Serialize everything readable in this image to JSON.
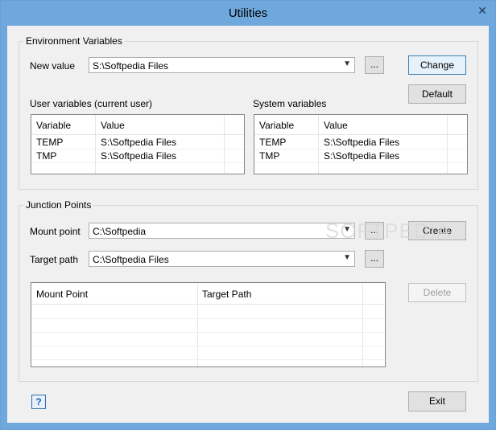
{
  "window": {
    "title": "Utilities"
  },
  "env": {
    "group_label": "Environment Variables",
    "new_value_label": "New value",
    "new_value": "S:\\Softpedia Files",
    "browse_label": "...",
    "change_label": "Change",
    "default_label": "Default",
    "user_vars_label": "User variables (current user)",
    "system_vars_label": "System variables",
    "columns": [
      "Variable",
      "Value"
    ],
    "user_rows": [
      {
        "variable": "TEMP",
        "value": "S:\\Softpedia Files"
      },
      {
        "variable": "TMP",
        "value": "S:\\Softpedia Files"
      }
    ],
    "system_rows": [
      {
        "variable": "TEMP",
        "value": "S:\\Softpedia Files"
      },
      {
        "variable": "TMP",
        "value": "S:\\Softpedia Files"
      }
    ]
  },
  "junction": {
    "group_label": "Junction Points",
    "mount_point_label": "Mount point",
    "mount_point_value": "C:\\Softpedia",
    "target_path_label": "Target path",
    "target_path_value": "C:\\Softpedia Files",
    "browse_label": "...",
    "create_label": "Create",
    "delete_label": "Delete",
    "columns": [
      "Mount Point",
      "Target Path"
    ]
  },
  "footer": {
    "help_label": "?",
    "exit_label": "Exit"
  },
  "watermark": "SOFTPEDIA"
}
